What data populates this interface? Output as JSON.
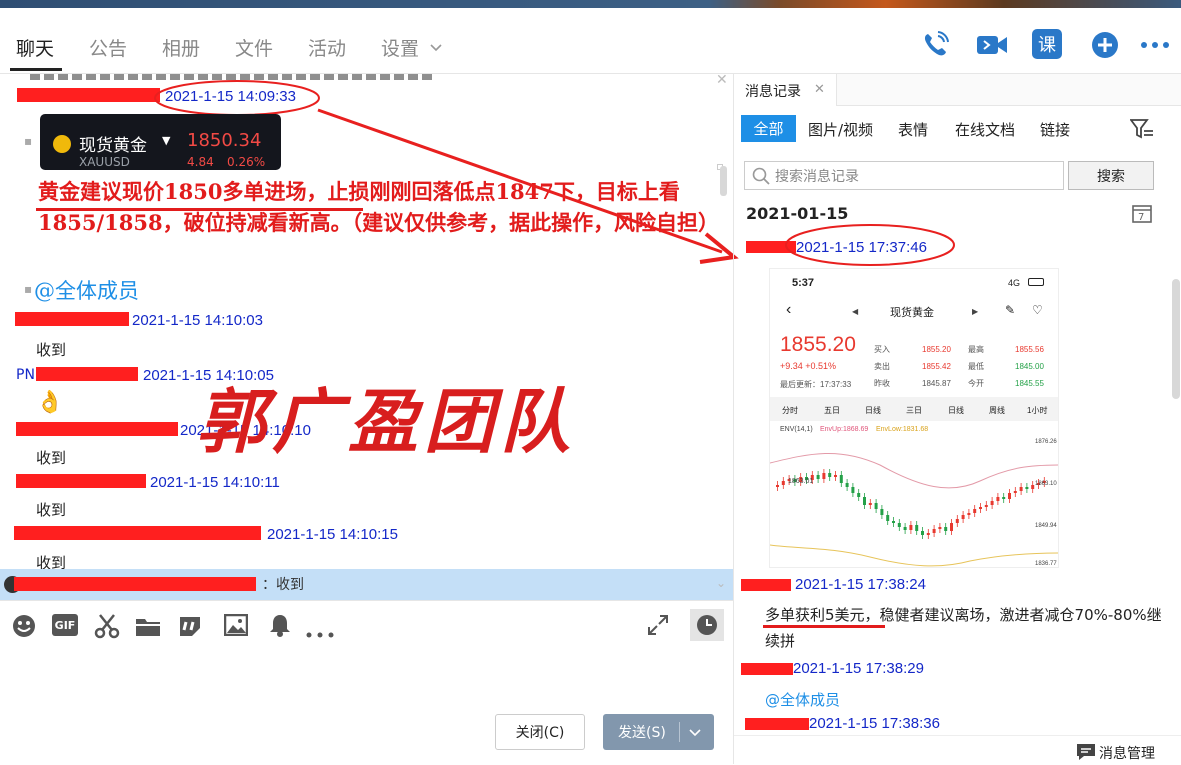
{
  "header": {
    "tabs": [
      "聊天",
      "公告",
      "相册",
      "文件",
      "活动",
      "设置"
    ],
    "active": "聊天",
    "icons": [
      "phone-icon",
      "video-icon",
      "class-icon",
      "add-icon",
      "more-icon"
    ],
    "class_label": "课"
  },
  "chat": {
    "messages": [
      {
        "time": "2021-1-15 14:09:33"
      },
      {
        "time": "2021-1-15 14:10:03",
        "text": "收到"
      },
      {
        "time": "2021-1-15 14:10:05",
        "text": "👌",
        "prefix": "PN"
      },
      {
        "time": "2021-1-15 14:10:10",
        "text": "收到"
      },
      {
        "time": "2021-1-15 14:10:11",
        "text": "收到"
      },
      {
        "time": "2021-1-15 14:10:15",
        "text": "收到"
      }
    ],
    "quote_card": {
      "name": "现货黄金",
      "code": "XAUUSD",
      "price": "1850.34",
      "change": "4.84",
      "pct": "0.26%"
    },
    "advice": "黄金建议现价1850多单进场，止损刚刚回落低点1847下，目标上看1855/1858，破位持减看新高。（建议仅供参考，据此操作，风险自担）",
    "mention": "@全体成员",
    "watermark": "郭广盈团队",
    "bubble_text": "：收到"
  },
  "toolbar": {
    "icons": [
      "emoji-icon",
      "gif-icon",
      "scissors-icon",
      "folder-icon",
      "quote-icon",
      "image-icon",
      "bell-icon",
      "more-icon"
    ],
    "gif_label": "GIF",
    "close_label": "关闭(C)",
    "send_label": "发送(S)"
  },
  "history": {
    "title": "消息记录",
    "filters": [
      "全部",
      "图片/视频",
      "表情",
      "在线文档",
      "链接"
    ],
    "search_placeholder": "搜索消息记录",
    "search_btn": "搜索",
    "date": "2021-01-15",
    "entries": [
      {
        "time": "2021-1-15 17:37:46"
      },
      {
        "time": "2021-1-15 17:38:24",
        "text_a": "多单获利5美元",
        "text_b": "，稳健者建议离场，激进者减仓70%-80%继续拼"
      },
      {
        "time": "2021-1-15 17:38:29",
        "text": "@全体成员"
      },
      {
        "time": "2021-1-15 17:38:36"
      }
    ],
    "manage_label": "消息管理"
  },
  "phone": {
    "clock": "5:37",
    "net": "4G",
    "title": "现货黄金",
    "price": "1855.20",
    "change": "+9.34 +0.51%",
    "updated": "最后更新：17:37:33",
    "stats": [
      [
        "买入",
        "1855.20",
        "最高",
        "1855.56"
      ],
      [
        "卖出",
        "1855.42",
        "最低",
        "1845.00"
      ],
      [
        "昨收",
        "1845.87",
        "今开",
        "1845.55"
      ]
    ],
    "tabs": [
      "分时",
      "五日",
      "日线",
      "三日",
      "日线",
      "周线",
      "1小时"
    ],
    "indicator": [
      "ENV(14,1)",
      "EnvUp:1868.69",
      "EnvLow:1831.68"
    ],
    "axis": [
      "1876.26",
      "1863.10",
      "1849.94",
      "1836.77"
    ],
    "peak": "1863.01"
  },
  "colors": {
    "accent": "#1e8fe6",
    "timestamp": "#1428c8",
    "redact": "#ff1f1f",
    "annot": "#e8201f"
  }
}
